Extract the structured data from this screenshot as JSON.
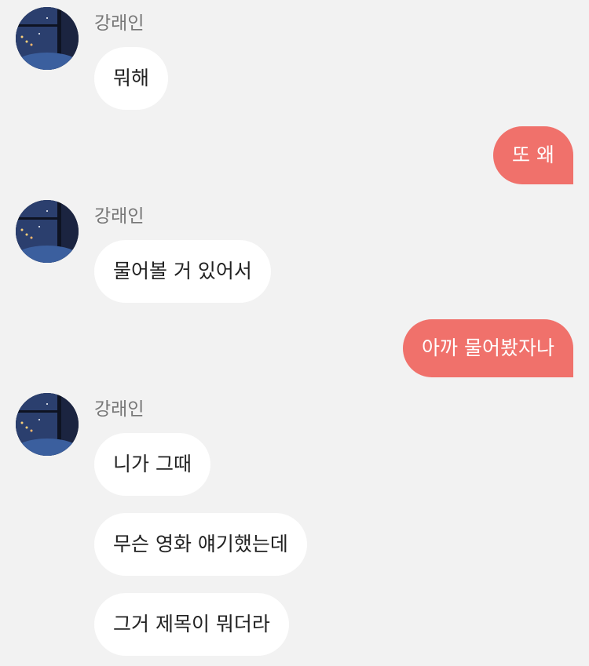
{
  "colors": {
    "background": "#f2f2f2",
    "incoming_bubble": "#ffffff",
    "outgoing_bubble": "#f0716b",
    "name_text": "#777777"
  },
  "messages": [
    {
      "type": "incoming-group",
      "sender": "강래인",
      "avatar_icon": "night-window-avatar",
      "lines": [
        "뭐해"
      ]
    },
    {
      "type": "outgoing",
      "text": "또 왜"
    },
    {
      "type": "incoming-group",
      "sender": "강래인",
      "avatar_icon": "night-window-avatar",
      "lines": [
        "물어볼 거 있어서"
      ]
    },
    {
      "type": "outgoing",
      "text": "아까 물어봤자나"
    },
    {
      "type": "incoming-group",
      "sender": "강래인",
      "avatar_icon": "night-window-avatar",
      "lines": [
        "니가 그때",
        "무슨 영화 얘기했는데",
        "그거 제목이 뭐더라"
      ]
    }
  ]
}
